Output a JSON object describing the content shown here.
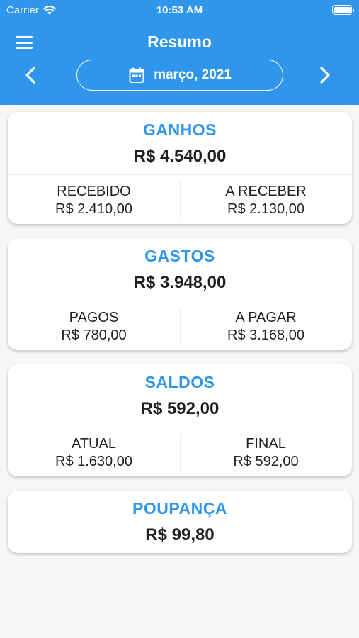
{
  "status": {
    "carrier": "Carrier",
    "time": "10:53 AM"
  },
  "header": {
    "title": "Resumo",
    "date": "março, 2021"
  },
  "colors": {
    "accent": "#2f96ec",
    "background": "#f6f6f6"
  },
  "icons": [
    "menu-icon",
    "chevron-left-icon",
    "chevron-right-icon",
    "calendar-icon",
    "wifi-icon",
    "battery-icon"
  ],
  "cards": {
    "ganhos": {
      "title": "GANHOS",
      "total": "R$ 4.540,00",
      "left_label": "RECEBIDO",
      "left_value": "R$ 2.410,00",
      "right_label": "A RECEBER",
      "right_value": "R$ 2.130,00"
    },
    "gastos": {
      "title": "GASTOS",
      "total": "R$ 3.948,00",
      "left_label": "PAGOS",
      "left_value": "R$ 780,00",
      "right_label": "A PAGAR",
      "right_value": "R$ 3.168,00"
    },
    "saldos": {
      "title": "SALDOS",
      "total": "R$ 592,00",
      "left_label": "ATUAL",
      "left_value": "R$ 1.630,00",
      "right_label": "FINAL",
      "right_value": "R$ 592,00"
    },
    "poupanca": {
      "title": "POUPANÇA",
      "total": "R$ 99,80"
    }
  }
}
